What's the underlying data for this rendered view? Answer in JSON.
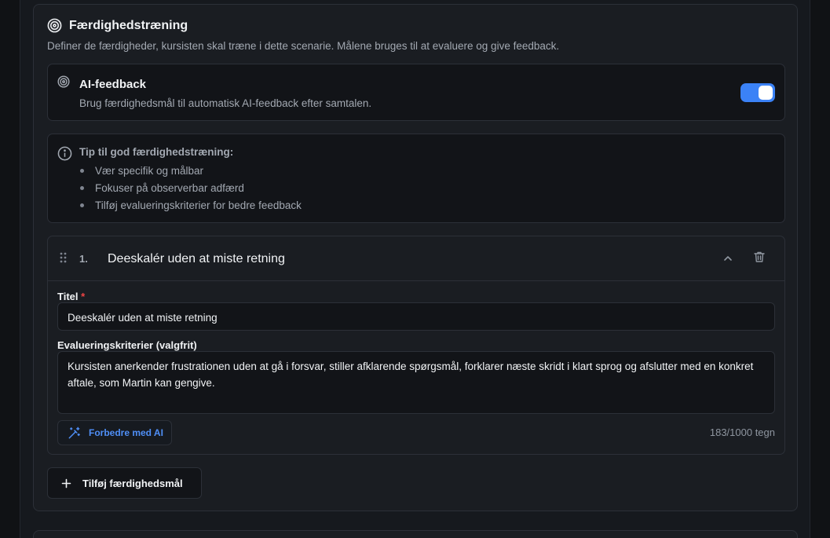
{
  "section": {
    "title": "Færdighedstræning",
    "description": "Definer de færdigheder, kursisten skal træne i dette scenarie. Målene bruges til at evaluere og give feedback."
  },
  "ai_feedback": {
    "title": "AI-feedback",
    "description": "Brug færdighedsmål til automatisk AI-feedback efter samtalen.",
    "enabled": true,
    "accent_color": "#3b82f6"
  },
  "tip": {
    "title": "Tip til god færdighedstræning:",
    "items": [
      "Vær specifik og målbar",
      "Fokuser på observerbar adfærd",
      "Tilføj evalueringskriterier for bedre feedback"
    ]
  },
  "skill": {
    "number": "1.",
    "name": "Deeskalér uden at miste retning",
    "title_label": "Titel",
    "required_mark": "*",
    "title_value": "Deeskalér uden at miste retning",
    "criteria_label": "Evalueringskriterier (valgfrit)",
    "criteria_value": "Kursisten anerkender frustrationen uden at gå i forsvar, stiller afklarende spørgsmål, forklarer næste skridt i klart sprog og afslutter med en konkret aftale, som Martin kan gengive.",
    "improve_label": "Forbedre med AI",
    "counter": "183/1000 tegn"
  },
  "add_button": {
    "label": "Tilføj færdighedsmål"
  }
}
